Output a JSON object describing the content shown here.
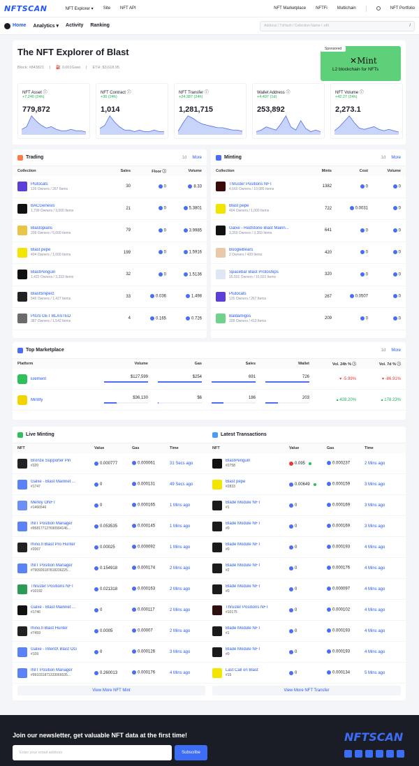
{
  "topbar": {
    "logo": "NFTSCAN",
    "nav": [
      "NFT Explorer ▾",
      "Site",
      "NFT API"
    ],
    "right": [
      "NFT Marketplace",
      "NFTFi",
      "Multichain",
      "NFT Portfolio"
    ]
  },
  "subbar": {
    "nav": [
      "Home",
      "Analytics ▾",
      "Activity",
      "Ranking"
    ],
    "search_placeholder": "Address / TxHash / Collection Name / .eth",
    "slash": "/"
  },
  "hero": {
    "title": "The NFT Explorer of Blast",
    "block": "Block: #843821",
    "gas": "0.001Gwei",
    "eth": "ETH: $3,618.95",
    "sponsor_tag": "Sponsored",
    "sponsor_brand": "Mint",
    "sponsor_tagline": "L2 blockchain for NFTs"
  },
  "stats": [
    {
      "label": "NFT Asset ⓘ",
      "change": "+7,240 (24h)",
      "value": "779,872",
      "spark": [
        4,
        6,
        14,
        10,
        7,
        5,
        6,
        4,
        3,
        3,
        4,
        3,
        3,
        2
      ]
    },
    {
      "label": "NFT Contract ⓘ",
      "change": "+36 (24h)",
      "value": "1,014",
      "spark": [
        4,
        6,
        12,
        8,
        5,
        3,
        3,
        2,
        3,
        2,
        2,
        3,
        2,
        2
      ]
    },
    {
      "label": "NFT Transfer ⓘ",
      "change": "+24,387 (24h)",
      "value": "1,281,715",
      "spark": [
        3,
        10,
        16,
        14,
        11,
        9,
        8,
        7,
        6,
        6,
        5,
        4,
        4,
        3
      ]
    },
    {
      "label": "Wallet Address ⓘ",
      "change": "+4,497 (1d)",
      "value": "253,892",
      "spark": [
        2,
        3,
        5,
        4,
        3,
        7,
        12,
        5,
        3,
        9,
        4,
        2,
        3,
        2
      ]
    },
    {
      "label": "NFT Volume ⓘ",
      "change": "+42.27 (24h)",
      "value": "2,273.1",
      "spark": [
        3,
        6,
        10,
        14,
        9,
        5,
        4,
        5,
        6,
        4,
        3,
        4,
        3,
        2
      ]
    }
  ],
  "trading": {
    "title": "Trading",
    "period": "1d",
    "more": "More",
    "cols": [
      "Collection",
      "Sales",
      "Floor ⓘ",
      "Volume"
    ],
    "rows": [
      {
        "name": "Plutocats",
        "sub": "126 Owners / 267 Items",
        "sales": "30",
        "floor": "0",
        "volume": "8.33",
        "color": "#5b3fd6"
      },
      {
        "name": "BACGenesis",
        "sub": "1,799 Owners / 3,000 Items",
        "sales": "21",
        "floor": "0",
        "volume": "5.3801",
        "color": "#111"
      },
      {
        "name": "Blastopians",
        "sub": "209 Owners / 5,000 Items",
        "sales": "79",
        "floor": "0",
        "volume": "3.9985",
        "color": "#e8c547"
      },
      {
        "name": "Blast pepe",
        "sub": "404 Owners / 1,000 Items",
        "sales": "199",
        "floor": "0",
        "volume": "1.5916",
        "color": "#f2e600"
      },
      {
        "name": "BlastPenguin",
        "sub": "1,422 Owners / 3,333 Items",
        "sales": "32",
        "floor": "0",
        "volume": "1.5136",
        "color": "#111"
      },
      {
        "name": "BlastSniperz",
        "sub": "546 Owners / 1,427 Items",
        "sales": "33",
        "floor": "0.036",
        "volume": "1.498",
        "color": "#222"
      },
      {
        "name": "PIGS GET BLASTED",
        "sub": "387 Owners / 1,542 Items",
        "sales": "4",
        "floor": "0.165",
        "volume": "0.726",
        "color": "#6b6b6b"
      }
    ]
  },
  "minting": {
    "title": "Minting",
    "period": "1d",
    "more": "More",
    "cols": [
      "Collection",
      "Mints",
      "Cost",
      "Volume"
    ],
    "rows": [
      {
        "name": "Thruster Positions NFT",
        "sub": "4,660 Owners / 10,085 Items",
        "mints": "1382",
        "cost": "0",
        "volume": "0",
        "color": "#3a0a0a"
      },
      {
        "name": "Blast pepe",
        "sub": "404 Owners / 1,000 Items",
        "mints": "722",
        "cost": "0.0031",
        "volume": "0",
        "color": "#f2e600"
      },
      {
        "name": "Galxe - RedStone Blast Mainn...",
        "sub": "3,359 Owners / 3,359 Items",
        "mints": "641",
        "cost": "0",
        "volume": "0",
        "color": "#111"
      },
      {
        "name": "BoogieBears",
        "sub": "2 Owners / 420 Items",
        "mints": "420",
        "cost": "0",
        "volume": "0",
        "color": "#e9c9a8"
      },
      {
        "name": "Spacebar Blast Protoships",
        "sub": "15,501 Owners / 15,501 Items",
        "mints": "320",
        "cost": "0",
        "volume": "0",
        "color": "#dfe7f5"
      },
      {
        "name": "Plutocats",
        "sub": "126 Owners / 267 Items",
        "mints": "267",
        "cost": "0.0507",
        "volume": "0",
        "color": "#5b3fd6"
      },
      {
        "name": "Baldamigos",
        "sub": "328 Owners / 413 Items",
        "mints": "209",
        "cost": "0",
        "volume": "0",
        "color": "#6fd38d"
      }
    ]
  },
  "market": {
    "title": "Top Marketplace",
    "period": "1d",
    "more": "More",
    "cols": [
      "Platform",
      "Volume",
      "Gas",
      "Sales",
      "Wallet",
      "Vol. 24h % ⓘ",
      "Vol. 7d % ⓘ"
    ],
    "rows": [
      {
        "name": "Element",
        "volume": "$127,599",
        "gas": "$254",
        "sales": "691",
        "wallet": "726",
        "v24": "▾ -5.99%",
        "v7": "▾ -86.91%",
        "v24c": "red",
        "v7c": "red",
        "vb": 1,
        "gb": 1,
        "sb": 1,
        "wb": 1,
        "color": "#2ec05a"
      },
      {
        "name": "Mintify",
        "volume": "$36,130",
        "gas": "$6",
        "sales": "186",
        "wallet": "203",
        "v24": "▴ 428.20%",
        "v7": "▴ 178.23%",
        "v24c": "green",
        "v7c": "green",
        "vb": 0.28,
        "gb": 0.02,
        "sb": 0.27,
        "wb": 0.28,
        "color": "#f2d400"
      }
    ]
  },
  "live": {
    "title": "Live Minting",
    "cols": [
      "NFT",
      "Value",
      "Gas",
      "Time"
    ],
    "view_more": "View More NFT Mint",
    "rows": [
      {
        "name": "Bronze Supporter Pin",
        "id": "#320",
        "value": "0.000777",
        "gas": "0.000061",
        "time": "31 Secs ago",
        "color": "#222"
      },
      {
        "name": "Galxe - Blast Mainnet ...",
        "id": "#1747",
        "value": "0",
        "gas": "0.000131",
        "time": "49 Secs ago",
        "color": "#5b83f7"
      },
      {
        "name": "Merkly ONFT",
        "id": "#1466546",
        "value": "0",
        "gas": "0.000165",
        "time": "1 Mins ago",
        "color": "#6b8ef7"
      },
      {
        "name": "INIT Position Manager",
        "id": "#958177127690994146...",
        "value": "0.053535",
        "gas": "0.000145",
        "time": "1 Mins ago",
        "color": "#5b83f7"
      },
      {
        "name": "rhino.fi Blast Pro Hunter",
        "id": "#2067",
        "value": "0.00025",
        "gas": "0.000092",
        "time": "1 Mins ago",
        "color": "#222"
      },
      {
        "name": "INIT Position Manager",
        "id": "#790926187818236225...",
        "value": "0.154918",
        "gas": "0.000174",
        "time": "2 Mins ago",
        "color": "#5b83f7"
      },
      {
        "name": "Thruster Positions NFT",
        "id": "#10192",
        "value": "0.021318",
        "gas": "0.000163",
        "time": "2 Mins ago",
        "color": "#2c9c55"
      },
      {
        "name": "Galxe - Blast Mainnet ...",
        "id": "#1746",
        "value": "0",
        "gas": "0.000117",
        "time": "2 Mins ago",
        "color": "#111"
      },
      {
        "name": "rhino.fi Blast Hunter",
        "id": "#7459",
        "value": "0.0005",
        "gas": "0.00007",
        "time": "2 Mins ago",
        "color": "#222"
      },
      {
        "name": "Galxe - IntentX Blast OG",
        "id": "#109",
        "value": "0",
        "gas": "0.000126",
        "time": "3 Mins ago",
        "color": "#5b83f7"
      },
      {
        "name": "INIT Position Manager",
        "id": "#991031871333066535...",
        "value": "0.260013",
        "gas": "0.000176",
        "time": "4 Mins ago",
        "color": "#5b83f7"
      }
    ]
  },
  "latest": {
    "title": "Latest Transactions",
    "cols": [
      "NFT",
      "Value",
      "Gas",
      "Time"
    ],
    "view_more": "View More NFT Transfer",
    "rows": [
      {
        "name": "BlastPenguin",
        "id": "#2758",
        "value": "0.095",
        "gas": "0.000237",
        "time": "2 Mins ago",
        "color": "#111",
        "dot": true,
        "red": true
      },
      {
        "name": "Blast pepe",
        "id": "#2833",
        "value": "0.00649",
        "gas": "0.000159",
        "time": "3 Mins ago",
        "color": "#f2e600",
        "dot": true,
        "red": false
      },
      {
        "name": "Blade Module NFT",
        "id": "#1",
        "value": "0",
        "gas": "0.000169",
        "time": "3 Mins ago",
        "color": "#1b1b1b"
      },
      {
        "name": "Blade Module NFT",
        "id": "#0",
        "value": "0",
        "gas": "0.000169",
        "time": "3 Mins ago",
        "color": "#1b1b1b"
      },
      {
        "name": "Blade Module NFT",
        "id": "#0",
        "value": "0",
        "gas": "0.000193",
        "time": "4 Mins ago",
        "color": "#1b1b1b"
      },
      {
        "name": "Blade Module NFT",
        "id": "#2",
        "value": "0",
        "gas": "0.000176",
        "time": "4 Mins ago",
        "color": "#1b1b1b"
      },
      {
        "name": "Blade Module NFT",
        "id": "#0",
        "value": "0",
        "gas": "0.000097",
        "time": "4 Mins ago",
        "color": "#1b1b1b"
      },
      {
        "name": "Thruster Positions NFT",
        "id": "#10175",
        "value": "0",
        "gas": "0.000102",
        "time": "4 Mins ago",
        "color": "#2c1010"
      },
      {
        "name": "Blade Module NFT",
        "id": "#1",
        "value": "0",
        "gas": "0.000193",
        "time": "4 Mins ago",
        "color": "#1b1b1b"
      },
      {
        "name": "Blade Module NFT",
        "id": "#0",
        "value": "0",
        "gas": "0.000193",
        "time": "4 Mins ago",
        "color": "#1b1b1b"
      },
      {
        "name": "Last Call on Blast",
        "id": "#15",
        "value": "0",
        "gas": "0.000134",
        "time": "5 Mins ago",
        "color": "#f2e600"
      }
    ]
  },
  "footer": {
    "title": "Join our newsletter, get valuable NFT data at the first time!",
    "placeholder": "Enter your email address",
    "button": "Subscribe",
    "logo": "NFTSCAN"
  }
}
